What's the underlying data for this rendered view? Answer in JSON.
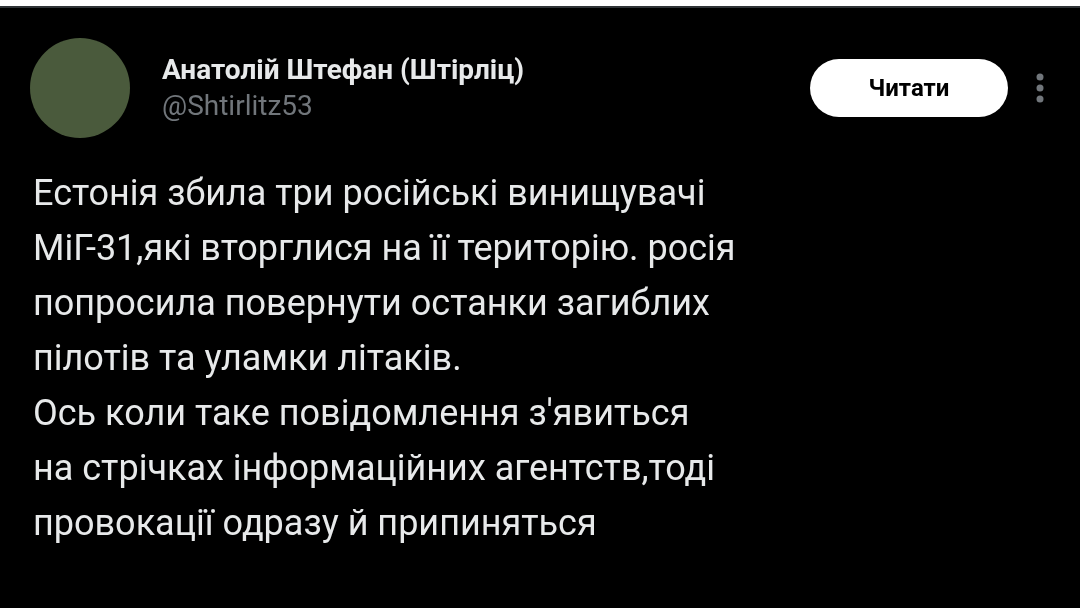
{
  "author": {
    "name": "Анатолій Штефан (Штірліц)",
    "handle": "@Shtirlitz53"
  },
  "follow_button": {
    "label": "Читати"
  },
  "post": {
    "paragraphs": [
      {
        "lines": [
          "Естонія збила три російські винищувачі",
          "МіГ-31,які вторглися на її територію. росія",
          "попросила повернути останки загиблих",
          "пілотів та уламки літаків."
        ]
      },
      {
        "lines": [
          "Ось коли таке повідомлення з'явиться",
          "на стрічках інформаційних агентств,тоді",
          "провокації одразу й припиняться"
        ]
      }
    ]
  }
}
